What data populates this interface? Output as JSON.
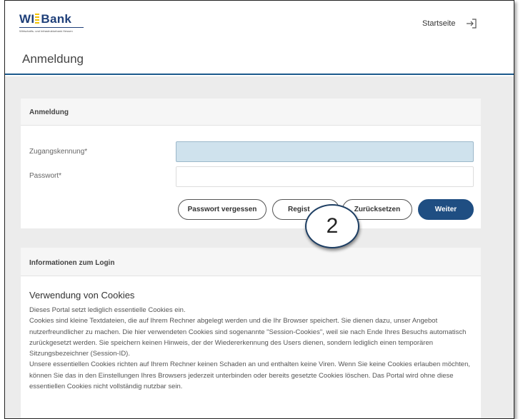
{
  "header": {
    "logo_main_left": "WI",
    "logo_main_right": "Bank",
    "logo_sub": "Wirtschafts- und Infrastrukturbank Hessen",
    "nav_home": "Startseite",
    "login_icon": "login-icon"
  },
  "page": {
    "title": "Anmeldung"
  },
  "login_card": {
    "header": "Anmeldung",
    "username_label": "Zugangskennung*",
    "username_value": "",
    "password_label": "Passwort*",
    "password_value": "",
    "buttons": {
      "forgot": "Passwort vergessen",
      "register": "Regist",
      "reset": "Zurücksetzen",
      "next": "Weiter"
    }
  },
  "badge": {
    "number": "2"
  },
  "info_card": {
    "header": "Informationen zum Login",
    "title": "Verwendung von Cookies",
    "paragraphs": [
      "Dieses Portal setzt lediglich essentielle Cookies ein.",
      "Cookies sind kleine Textdateien, die auf Ihrem Rechner abgelegt werden und die Ihr Browser speichert. Sie dienen dazu, unser Angebot nutzerfreundlicher zu machen. Die hier verwendeten Cookies sind sogenannte \"Session-Cookies\", weil sie nach Ende Ihres Besuchs automatisch zurückgesetzt werden. Sie speichern keinen Hinweis, der der Wiedererkennung des Users dienen, sondern lediglich einen temporären Sitzungsbezeichner (Session-ID).",
      "Unsere essentiellen Cookies richten auf Ihrem Rechner keinen Schaden an und enthalten keine Viren. Wenn Sie keine Cookies erlauben möchten, können Sie das in den Einstellungen Ihres Browsers jederzeit unterbinden oder bereits gesetzte Cookies löschen. Das Portal wird ohne diese essentiellen Cookies nicht vollständig nutzbar sein."
    ]
  },
  "colors": {
    "brand_blue": "#1f4e82",
    "header_rule": "#1c5a8c",
    "active_input": "#cfe2ed",
    "logo_yellow": "#f2c100",
    "page_background": "#ececec"
  }
}
